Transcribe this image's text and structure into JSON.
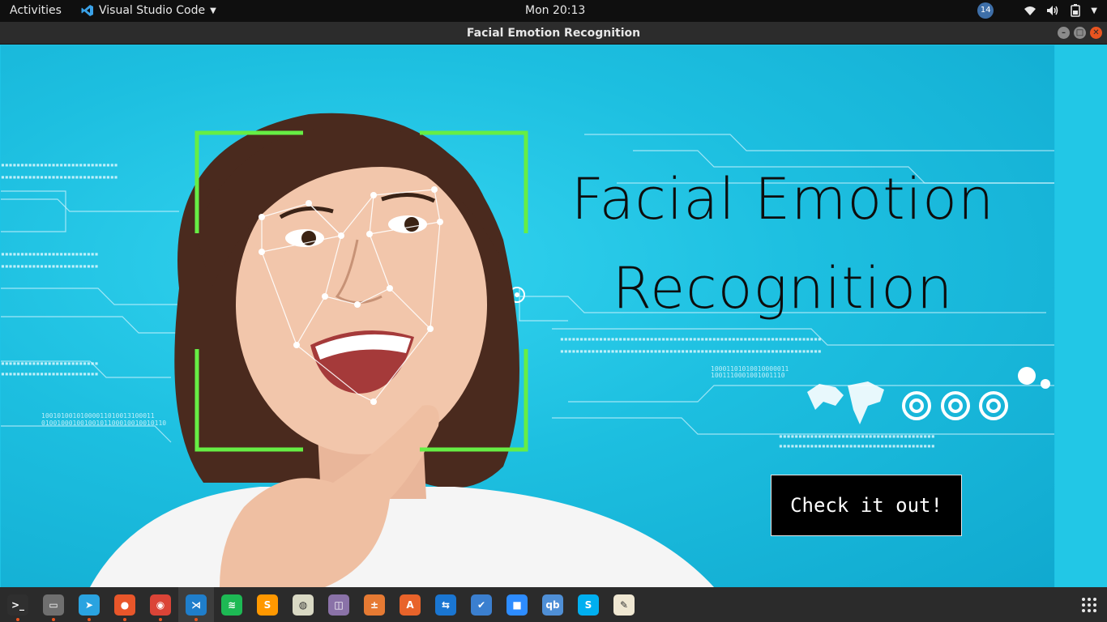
{
  "topbar": {
    "activities": "Activities",
    "app_name": "Visual Studio Code",
    "clock": "Mon 20:13",
    "notification_count": "14"
  },
  "window": {
    "title": "Facial Emotion Recognition"
  },
  "hero": {
    "title_line1": "Facial Emotion",
    "title_line2": "Recognition",
    "cta_label": "Check it out!",
    "binary_text_1": "10010100101000011010013100011",
    "binary_text_2": "01001000100100101100010010010110",
    "binary_text_3": "10001101010010000011",
    "binary_text_4": "1001110001001001110"
  },
  "colors": {
    "background": "#1dbfe0",
    "face_frame": "#66ee44",
    "title": "#0d0d0d",
    "button_bg": "#000000",
    "close_button": "#e95420"
  },
  "dock": {
    "items": [
      {
        "icon": "terminal-icon",
        "glyph": ">_",
        "color": "#2f2f2f",
        "running": true
      },
      {
        "icon": "files-icon",
        "glyph": "▭",
        "color": "#6f6f6f",
        "running": true
      },
      {
        "icon": "telegram-icon",
        "glyph": "➤",
        "color": "#2aa3e0",
        "running": true
      },
      {
        "icon": "firefox-icon",
        "glyph": "●",
        "color": "#e8562a",
        "running": true
      },
      {
        "icon": "chrome-icon",
        "glyph": "◉",
        "color": "#db4437",
        "running": true
      },
      {
        "icon": "vscode-icon",
        "glyph": "⋊",
        "color": "#1f7ecb",
        "running": true
      },
      {
        "icon": "spotify-icon",
        "glyph": "≋",
        "color": "#1db954",
        "running": false
      },
      {
        "icon": "sublime-text-icon",
        "glyph": "S",
        "color": "#ff9800",
        "running": false
      },
      {
        "icon": "media-player-icon",
        "glyph": "◍",
        "color": "#d9d9c4",
        "running": false
      },
      {
        "icon": "screenshot-icon",
        "glyph": "◫",
        "color": "#8a72a8",
        "running": false
      },
      {
        "icon": "calculator-icon",
        "glyph": "±",
        "color": "#e67a33",
        "running": false
      },
      {
        "icon": "software-center-icon",
        "glyph": "A",
        "color": "#e8632a",
        "running": false
      },
      {
        "icon": "teamviewer-icon",
        "glyph": "⇆",
        "color": "#1a76d2",
        "running": false
      },
      {
        "icon": "tasks-icon",
        "glyph": "✔",
        "color": "#3b7fcf",
        "running": false
      },
      {
        "icon": "zoom-icon",
        "glyph": "■",
        "color": "#2d8cff",
        "running": false
      },
      {
        "icon": "qbittorrent-icon",
        "glyph": "qb",
        "color": "#4f8fd6",
        "running": false
      },
      {
        "icon": "skype-icon",
        "glyph": "S",
        "color": "#00aff0",
        "running": false
      },
      {
        "icon": "text-editor-icon",
        "glyph": "✎",
        "color": "#efe7d2",
        "running": false
      }
    ]
  }
}
